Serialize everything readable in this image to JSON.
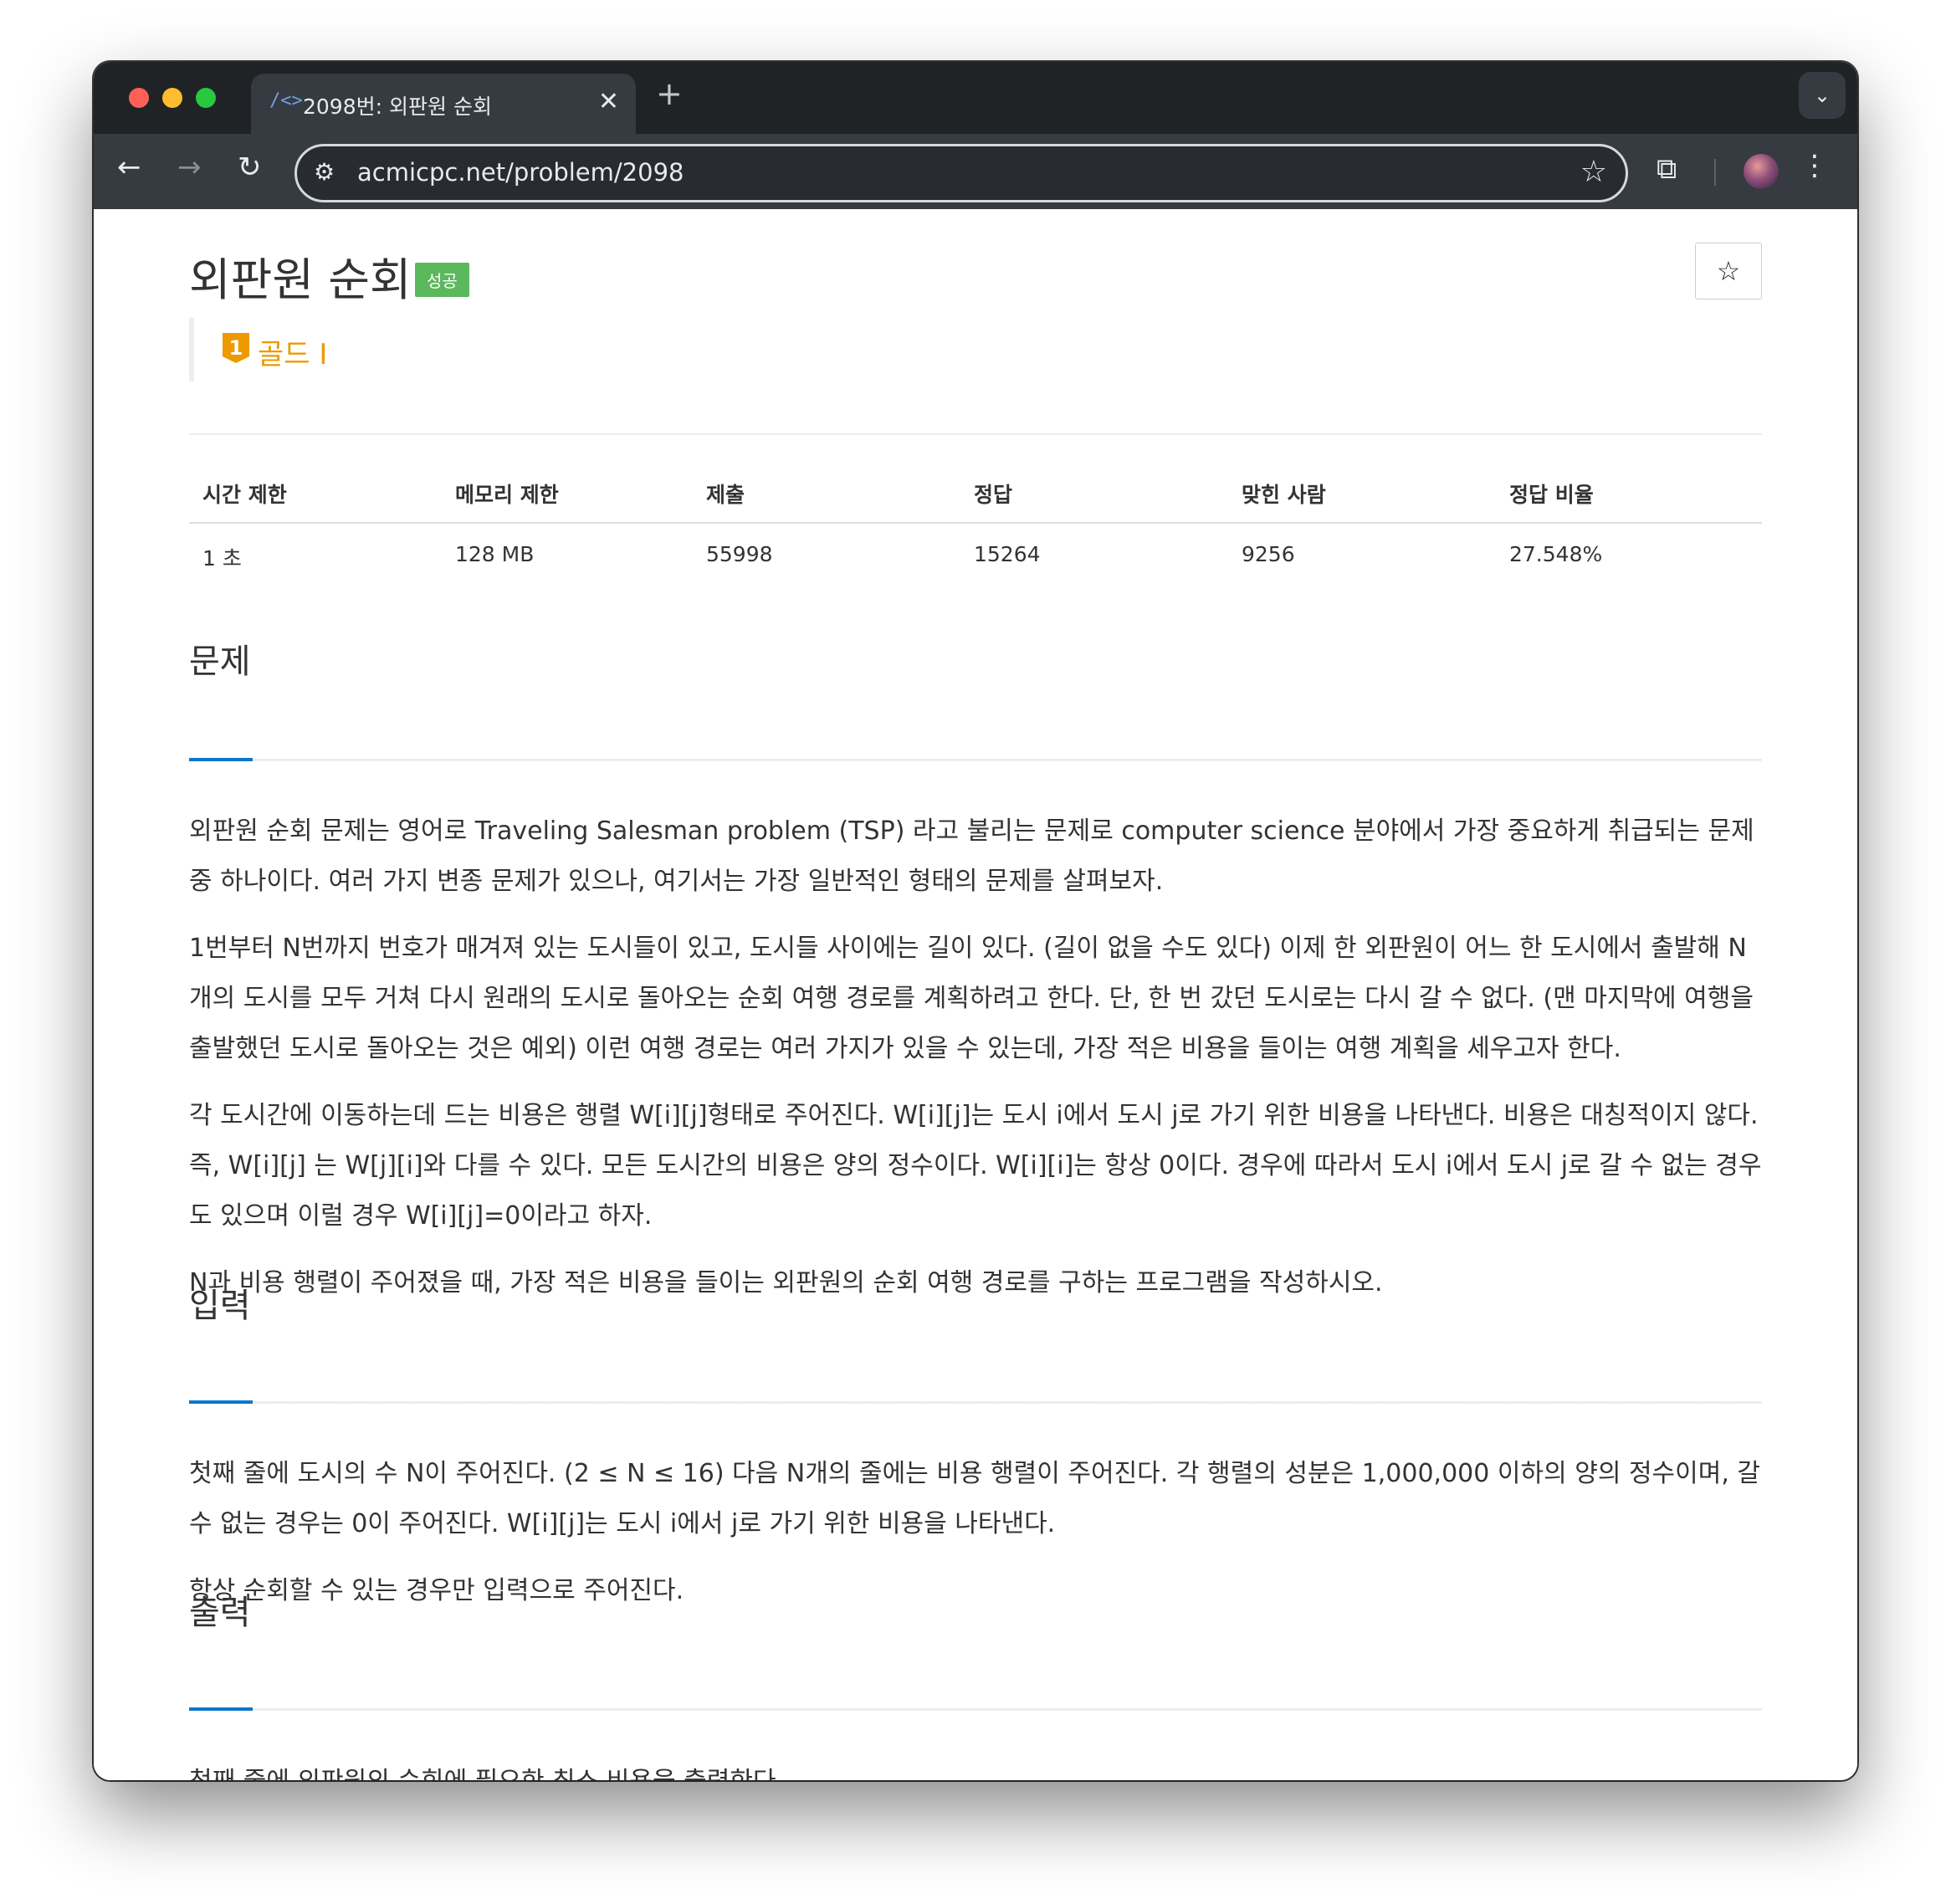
{
  "browser": {
    "tab_title": "2098번: 외판원 순회",
    "tab_favicon": "/<>",
    "tab_close": "✕",
    "new_tab": "+",
    "tab_dropdown": "⌄",
    "url": "acmicpc.net/problem/2098",
    "icons": {
      "back": "←",
      "forward": "→",
      "reload": "↻",
      "site_info": "⚙",
      "bookmark": "☆",
      "extensions": "⧉",
      "menu": "⋮"
    }
  },
  "problem": {
    "title": "외판원 순회",
    "status_badge": "성공",
    "bookmark_icon": "☆",
    "tier_number": "1",
    "tier_label": "골드 I",
    "tier_color": "#ec9a00",
    "stats": {
      "headers": [
        "시간 제한",
        "메모리 제한",
        "제출",
        "정답",
        "맞힌 사람",
        "정답 비율"
      ],
      "values": [
        "1 초",
        "128 MB",
        "55998",
        "15264",
        "9256",
        "27.548%"
      ]
    }
  },
  "sections": {
    "description": {
      "title": "문제",
      "paragraphs": [
        "외판원 순회 문제는 영어로 Traveling Salesman problem (TSP) 라고 불리는 문제로 computer science 분야에서 가장 중요하게 취급되는 문제 중 하나이다. 여러 가지 변종 문제가 있으나, 여기서는 가장 일반적인 형태의 문제를 살펴보자.",
        "1번부터 N번까지 번호가 매겨져 있는 도시들이 있고, 도시들 사이에는 길이 있다. (길이 없을 수도 있다) 이제 한 외판원이 어느 한 도시에서 출발해 N개의 도시를 모두 거쳐 다시 원래의 도시로 돌아오는 순회 여행 경로를 계획하려고 한다. 단, 한 번 갔던 도시로는 다시 갈 수 없다. (맨 마지막에 여행을 출발했던 도시로 돌아오는 것은 예외) 이런 여행 경로는 여러 가지가 있을 수 있는데, 가장 적은 비용을 들이는 여행 계획을 세우고자 한다.",
        "각 도시간에 이동하는데 드는 비용은 행렬 W[i][j]형태로 주어진다. W[i][j]는 도시 i에서 도시 j로 가기 위한 비용을 나타낸다. 비용은 대칭적이지 않다. 즉, W[i][j] 는 W[j][i]와 다를 수 있다. 모든 도시간의 비용은 양의 정수이다. W[i][i]는 항상 0이다. 경우에 따라서 도시 i에서 도시 j로 갈 수 없는 경우도 있으며 이럴 경우 W[i][j]=0이라고 하자.",
        "N과 비용 행렬이 주어졌을 때, 가장 적은 비용을 들이는 외판원의 순회 여행 경로를 구하는 프로그램을 작성하시오."
      ]
    },
    "input": {
      "title": "입력",
      "paragraphs": [
        "첫째 줄에 도시의 수 N이 주어진다. (2 ≤ N ≤ 16) 다음 N개의 줄에는 비용 행렬이 주어진다. 각 행렬의 성분은 1,000,000 이하의 양의 정수이며, 갈 수 없는 경우는 0이 주어진다. W[i][j]는 도시 i에서 j로 가기 위한 비용을 나타낸다.",
        "항상 순회할 수 있는 경우만 입력으로 주어진다."
      ]
    },
    "output": {
      "title": "출력",
      "paragraphs": [
        "첫째 줄에 외판원의 순회에 필요한 최소 비용을 출력한다."
      ]
    }
  }
}
